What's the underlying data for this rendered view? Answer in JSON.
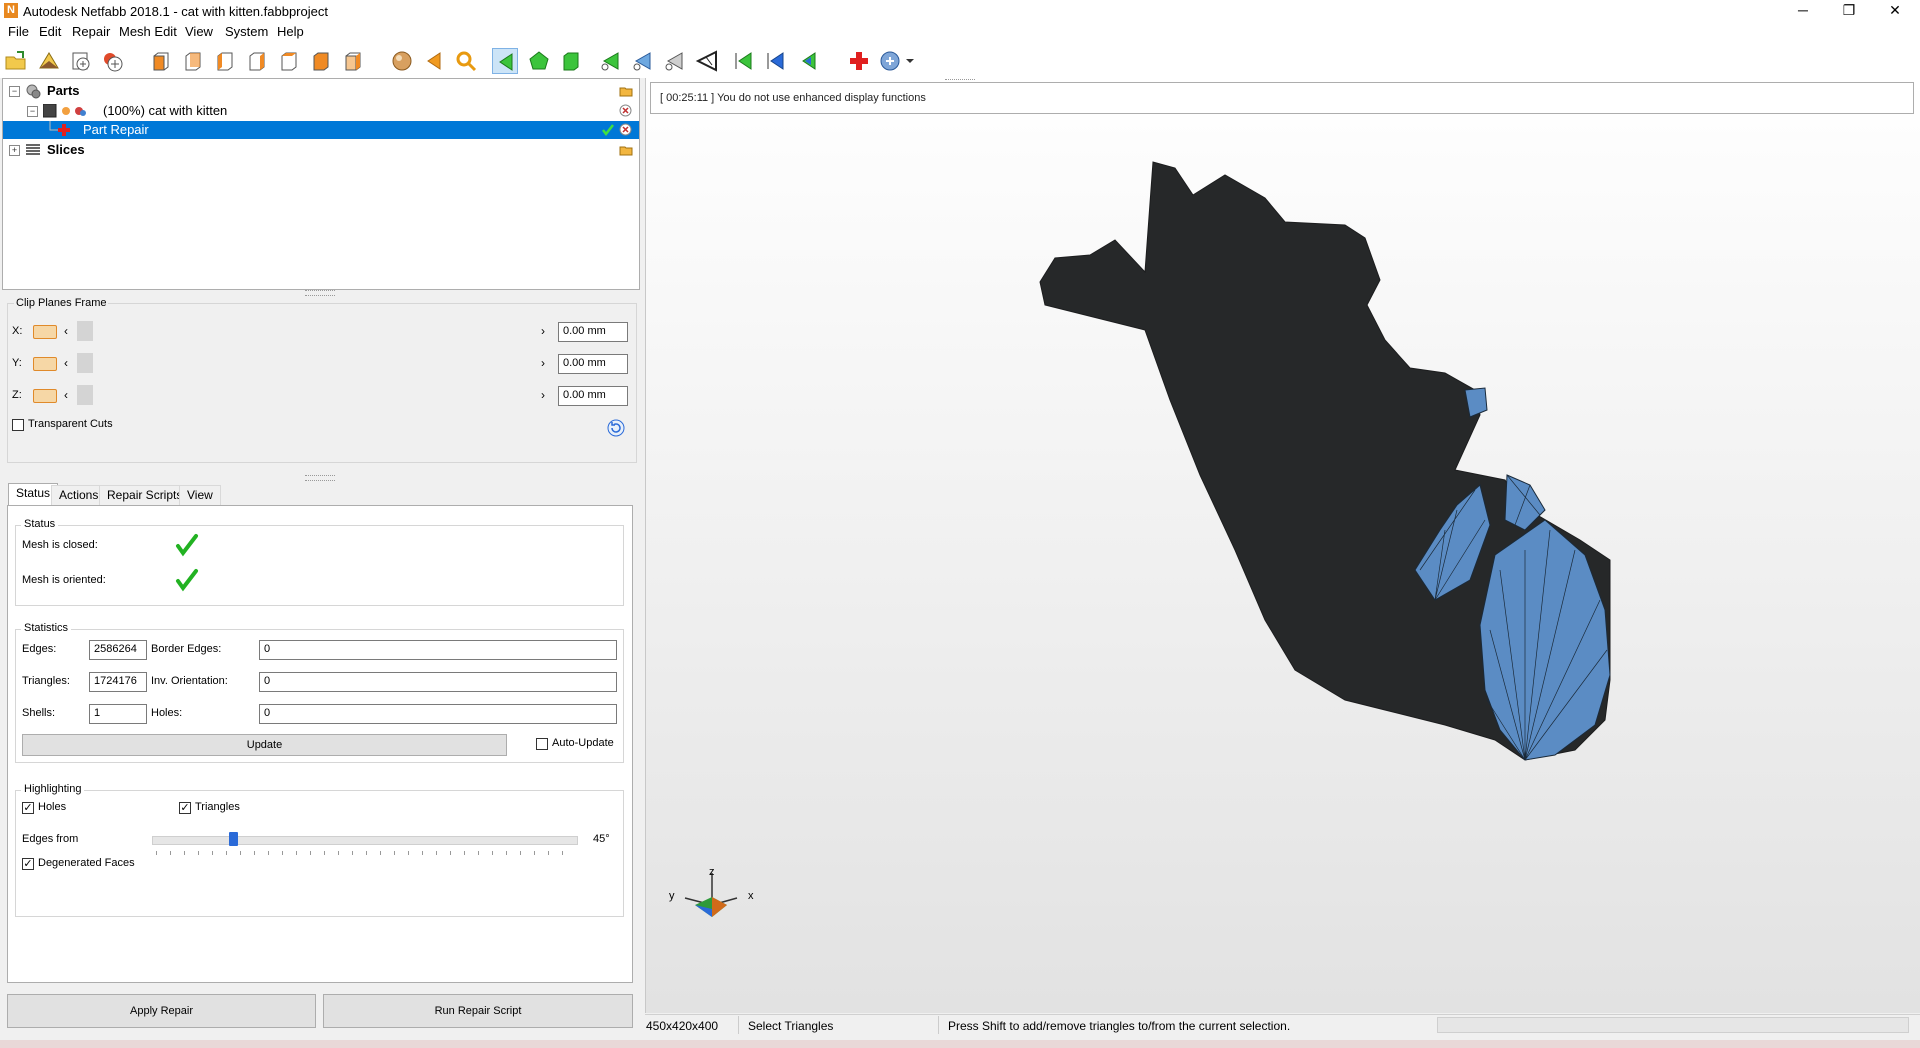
{
  "window": {
    "title": "Autodesk Netfabb 2018.1 - cat with kitten.fabbproject",
    "logo_letter": "N",
    "controls": [
      "─",
      "❐",
      "✕"
    ]
  },
  "menu": [
    "File",
    "Edit",
    "Repair",
    "Mesh Edit",
    "View",
    "System",
    "Help"
  ],
  "toolbar_icons": [
    "open-project-icon",
    "add-part-icon",
    "import-icon",
    "add-icon",
    "view-front-icon",
    "view-back-icon",
    "view-left-icon",
    "view-right-icon",
    "view-top-icon",
    "view-bottom-icon",
    "view-iso-icon",
    "sphere-icon",
    "back-arrow-icon",
    "zoom-icon",
    "select-triangles-icon",
    "select-surface-icon",
    "select-shell-icon",
    "add-triangle-icon",
    "move-point-icon",
    "edge-icon",
    "cut-icon",
    "triangle-green-icon",
    "triangle-blue-icon",
    "triangle-outline-icon",
    "repair-cross-icon",
    "repair-menu-icon"
  ],
  "tree": {
    "parts_label": "Parts",
    "part_name": "(100%) cat with kitten",
    "repair_label": "Part Repair",
    "slices_label": "Slices"
  },
  "clip_planes": {
    "title": "Clip Planes Frame",
    "axes": [
      {
        "label": "X:",
        "value": "0.00 mm"
      },
      {
        "label": "Y:",
        "value": "0.00 mm"
      },
      {
        "label": "Z:",
        "value": "0.00 mm"
      }
    ],
    "transparent_label": "Transparent Cuts"
  },
  "tabs": [
    "Status",
    "Actions",
    "Repair Scripts",
    "View"
  ],
  "status": {
    "group_title": "Status",
    "closed_label": "Mesh is closed:",
    "oriented_label": "Mesh is oriented:"
  },
  "statistics": {
    "group_title": "Statistics",
    "edges_label": "Edges:",
    "edges_value": "2586264",
    "border_edges_label": "Border Edges:",
    "border_edges_value": "0",
    "triangles_label": "Triangles:",
    "triangles_value": "1724176",
    "inv_orientation_label": "Inv. Orientation:",
    "inv_orientation_value": "0",
    "shells_label": "Shells:",
    "shells_value": "1",
    "holes_label": "Holes:",
    "holes_value": "0",
    "update_label": "Update",
    "auto_update_label": "Auto-Update"
  },
  "highlighting": {
    "group_title": "Highlighting",
    "holes_label": "Holes",
    "triangles_label": "Triangles",
    "edges_from_label": "Edges from",
    "edges_angle": "45°",
    "edges_angle_fraction": 0.19,
    "degenerated_label": "Degenerated Faces"
  },
  "buttons": {
    "apply_repair": "Apply Repair",
    "run_script": "Run Repair Script"
  },
  "viewport": {
    "log_message": "[ 00:25:11 ] You do not use enhanced display functions",
    "axis_z": "z",
    "axis_y": "y",
    "axis_x": "x",
    "mesh_color": "#262829",
    "highlight_color": "#5b8cc4"
  },
  "statusbar": {
    "dimensions": "450x420x400",
    "mode": "Select Triangles",
    "hint": "Press Shift to add/remove triangles to/from the current selection."
  }
}
